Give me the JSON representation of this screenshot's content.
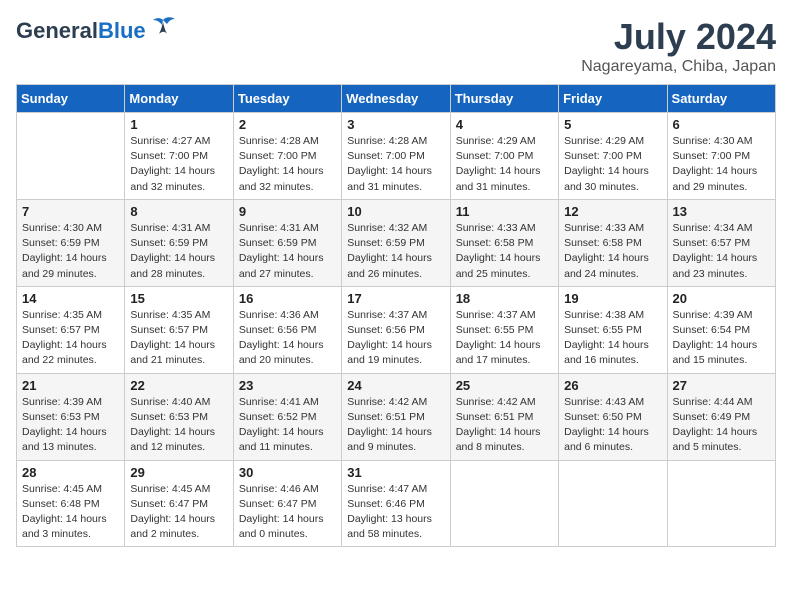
{
  "header": {
    "logo_general": "General",
    "logo_blue": "Blue",
    "title": "July 2024",
    "location": "Nagareyama, Chiba, Japan"
  },
  "calendar": {
    "days_of_week": [
      "Sunday",
      "Monday",
      "Tuesday",
      "Wednesday",
      "Thursday",
      "Friday",
      "Saturday"
    ],
    "weeks": [
      [
        {
          "day": "",
          "info": ""
        },
        {
          "day": "1",
          "info": "Sunrise: 4:27 AM\nSunset: 7:00 PM\nDaylight: 14 hours\nand 32 minutes."
        },
        {
          "day": "2",
          "info": "Sunrise: 4:28 AM\nSunset: 7:00 PM\nDaylight: 14 hours\nand 32 minutes."
        },
        {
          "day": "3",
          "info": "Sunrise: 4:28 AM\nSunset: 7:00 PM\nDaylight: 14 hours\nand 31 minutes."
        },
        {
          "day": "4",
          "info": "Sunrise: 4:29 AM\nSunset: 7:00 PM\nDaylight: 14 hours\nand 31 minutes."
        },
        {
          "day": "5",
          "info": "Sunrise: 4:29 AM\nSunset: 7:00 PM\nDaylight: 14 hours\nand 30 minutes."
        },
        {
          "day": "6",
          "info": "Sunrise: 4:30 AM\nSunset: 7:00 PM\nDaylight: 14 hours\nand 29 minutes."
        }
      ],
      [
        {
          "day": "7",
          "info": "Sunrise: 4:30 AM\nSunset: 6:59 PM\nDaylight: 14 hours\nand 29 minutes."
        },
        {
          "day": "8",
          "info": "Sunrise: 4:31 AM\nSunset: 6:59 PM\nDaylight: 14 hours\nand 28 minutes."
        },
        {
          "day": "9",
          "info": "Sunrise: 4:31 AM\nSunset: 6:59 PM\nDaylight: 14 hours\nand 27 minutes."
        },
        {
          "day": "10",
          "info": "Sunrise: 4:32 AM\nSunset: 6:59 PM\nDaylight: 14 hours\nand 26 minutes."
        },
        {
          "day": "11",
          "info": "Sunrise: 4:33 AM\nSunset: 6:58 PM\nDaylight: 14 hours\nand 25 minutes."
        },
        {
          "day": "12",
          "info": "Sunrise: 4:33 AM\nSunset: 6:58 PM\nDaylight: 14 hours\nand 24 minutes."
        },
        {
          "day": "13",
          "info": "Sunrise: 4:34 AM\nSunset: 6:57 PM\nDaylight: 14 hours\nand 23 minutes."
        }
      ],
      [
        {
          "day": "14",
          "info": "Sunrise: 4:35 AM\nSunset: 6:57 PM\nDaylight: 14 hours\nand 22 minutes."
        },
        {
          "day": "15",
          "info": "Sunrise: 4:35 AM\nSunset: 6:57 PM\nDaylight: 14 hours\nand 21 minutes."
        },
        {
          "day": "16",
          "info": "Sunrise: 4:36 AM\nSunset: 6:56 PM\nDaylight: 14 hours\nand 20 minutes."
        },
        {
          "day": "17",
          "info": "Sunrise: 4:37 AM\nSunset: 6:56 PM\nDaylight: 14 hours\nand 19 minutes."
        },
        {
          "day": "18",
          "info": "Sunrise: 4:37 AM\nSunset: 6:55 PM\nDaylight: 14 hours\nand 17 minutes."
        },
        {
          "day": "19",
          "info": "Sunrise: 4:38 AM\nSunset: 6:55 PM\nDaylight: 14 hours\nand 16 minutes."
        },
        {
          "day": "20",
          "info": "Sunrise: 4:39 AM\nSunset: 6:54 PM\nDaylight: 14 hours\nand 15 minutes."
        }
      ],
      [
        {
          "day": "21",
          "info": "Sunrise: 4:39 AM\nSunset: 6:53 PM\nDaylight: 14 hours\nand 13 minutes."
        },
        {
          "day": "22",
          "info": "Sunrise: 4:40 AM\nSunset: 6:53 PM\nDaylight: 14 hours\nand 12 minutes."
        },
        {
          "day": "23",
          "info": "Sunrise: 4:41 AM\nSunset: 6:52 PM\nDaylight: 14 hours\nand 11 minutes."
        },
        {
          "day": "24",
          "info": "Sunrise: 4:42 AM\nSunset: 6:51 PM\nDaylight: 14 hours\nand 9 minutes."
        },
        {
          "day": "25",
          "info": "Sunrise: 4:42 AM\nSunset: 6:51 PM\nDaylight: 14 hours\nand 8 minutes."
        },
        {
          "day": "26",
          "info": "Sunrise: 4:43 AM\nSunset: 6:50 PM\nDaylight: 14 hours\nand 6 minutes."
        },
        {
          "day": "27",
          "info": "Sunrise: 4:44 AM\nSunset: 6:49 PM\nDaylight: 14 hours\nand 5 minutes."
        }
      ],
      [
        {
          "day": "28",
          "info": "Sunrise: 4:45 AM\nSunset: 6:48 PM\nDaylight: 14 hours\nand 3 minutes."
        },
        {
          "day": "29",
          "info": "Sunrise: 4:45 AM\nSunset: 6:47 PM\nDaylight: 14 hours\nand 2 minutes."
        },
        {
          "day": "30",
          "info": "Sunrise: 4:46 AM\nSunset: 6:47 PM\nDaylight: 14 hours\nand 0 minutes."
        },
        {
          "day": "31",
          "info": "Sunrise: 4:47 AM\nSunset: 6:46 PM\nDaylight: 13 hours\nand 58 minutes."
        },
        {
          "day": "",
          "info": ""
        },
        {
          "day": "",
          "info": ""
        },
        {
          "day": "",
          "info": ""
        }
      ]
    ]
  }
}
